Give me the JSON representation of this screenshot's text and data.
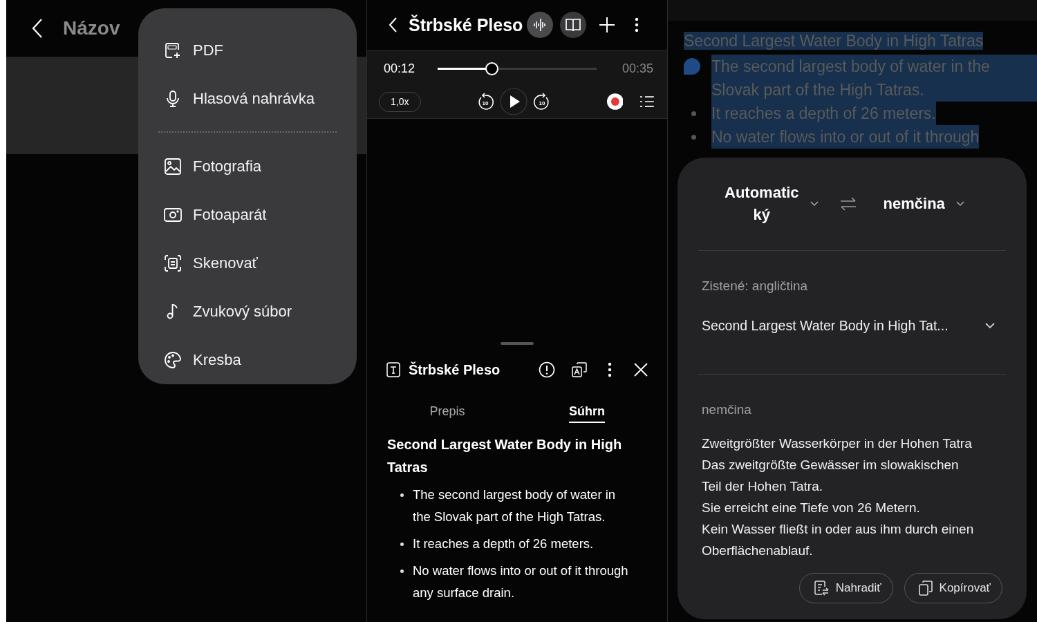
{
  "note_screen": {
    "title": "Názov",
    "menu": {
      "groups": [
        {
          "items": [
            {
              "label": "PDF",
              "kind": "pdf"
            },
            {
              "label": "Hlasová nahrávka",
              "kind": "voice"
            }
          ]
        },
        {
          "items": [
            {
              "label": "Fotografia",
              "kind": "photo"
            },
            {
              "label": "Fotoaparát",
              "kind": "camera"
            },
            {
              "label": "Skenovať",
              "kind": "scan"
            },
            {
              "label": "Zvukový súbor",
              "kind": "audio"
            },
            {
              "label": "Kresba",
              "kind": "drawing"
            }
          ]
        }
      ]
    }
  },
  "recorder_screen": {
    "title": "Štrbské Pleso",
    "player": {
      "elapsed": "00:12",
      "total": "00:35",
      "level": 0.34,
      "speed": "1,0x",
      "skip_back": "10",
      "skip_forward": "10"
    },
    "summary_sheet": {
      "title": "Štrbské Pleso",
      "tabs": [
        {
          "label": "Prepis",
          "selected": false
        },
        {
          "label": "Súhrn",
          "selected": true
        }
      ],
      "heading": "Second Largest Water Body in High Tatras",
      "bullets": [
        "The second largest body of water in the Slovak part of the High Tatras.",
        "It reaches a depth of 26 meters.",
        "No water flows into or out of it through any surface drain."
      ]
    }
  },
  "translate_screen": {
    "document": {
      "selected": true,
      "heading": "Second Largest Water Body in High Tatras",
      "bullets": [
        "The second largest body of water in the Slovak part of the High Tatras.",
        "It reaches a depth of 26 meters.",
        "No water flows into or out of it through"
      ]
    },
    "translator": {
      "source_language": [
        "Automatic",
        "ký"
      ],
      "target_language": "nemčina",
      "detected": "Zistené: angličtina",
      "source_text": "Second Largest Water Body in High Tat...",
      "target_label": "nemčina",
      "translation": [
        "Zweitgrößter Wasserkörper in der Hohen Tatra",
        "Das zweitgrößte Gewässer im slowakischen Teil der Hohen Tatra.",
        "Sie erreicht eine Tiefe von 26 Metern.",
        "Kein Wasser fließt in oder aus ihm durch einen Oberflächenablauf."
      ],
      "buttons": [
        {
          "label": "Nahradiť",
          "kind": "replace"
        },
        {
          "label": "Kopírovať",
          "kind": "copy"
        }
      ]
    }
  }
}
